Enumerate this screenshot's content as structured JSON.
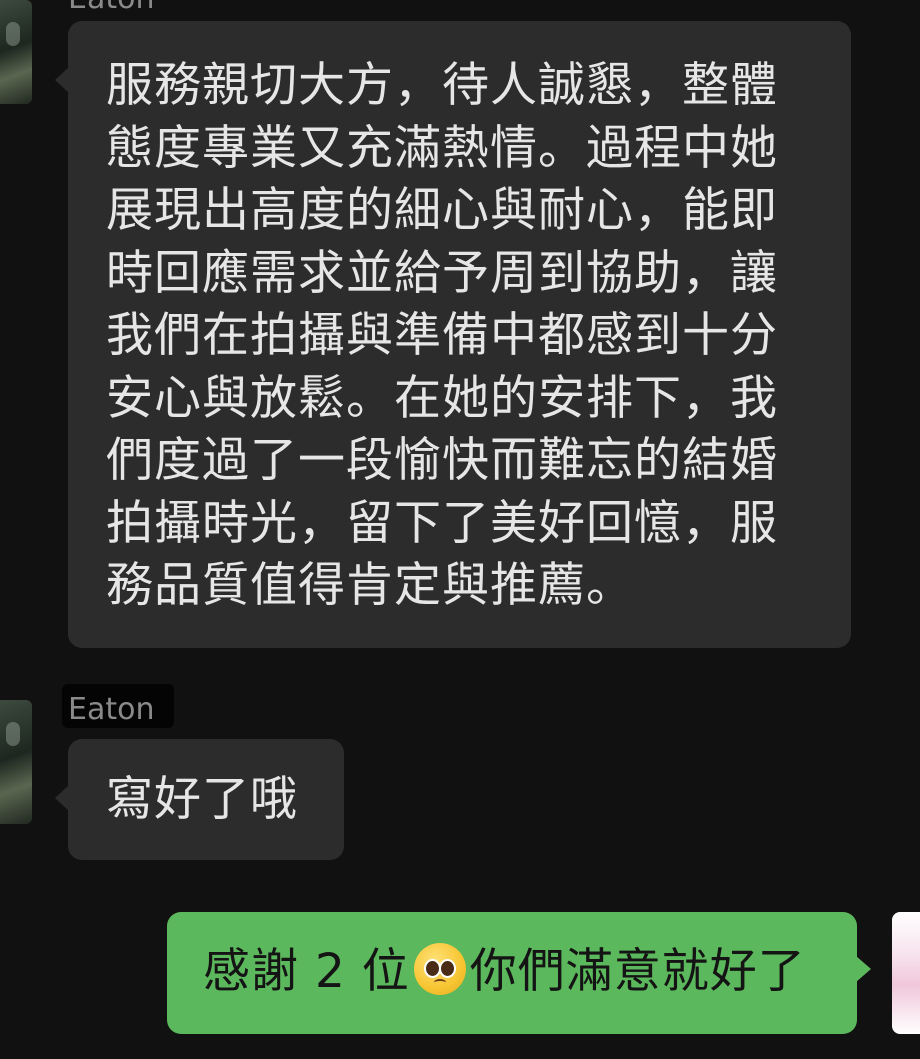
{
  "chat": {
    "incoming_name_top": "Eaton",
    "message_long": "服務親切大方，待人誠懇，整體態度專業又充滿熱情。過程中她展現出高度的細心與耐心，能即時回應需求並給予周到協助，讓我們在拍攝與準備中都感到十分安心與放鬆。在她的安排下，我們度過了一段愉快而難忘的結婚拍攝時光，留下了美好回憶，服務品質值得肯定與推薦。",
    "incoming_name_bottom": "Eaton",
    "message_short": "寫好了哦",
    "reply_before_emoji": "感謝 2 位",
    "reply_emoji": "pleading-face-emoji",
    "reply_after_emoji": "你們滿意就好了"
  },
  "colors": {
    "background": "#111111",
    "incoming_bubble": "#2c2c2c",
    "outgoing_bubble": "#5cb85c"
  }
}
